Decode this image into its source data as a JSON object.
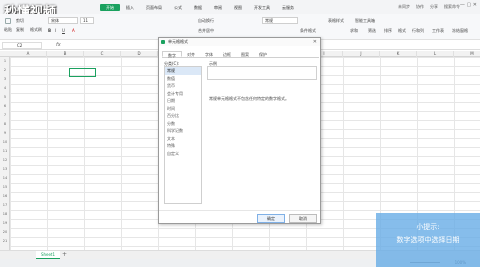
{
  "watermark": "秒懂视频",
  "menu": {
    "items": [
      "开始",
      "插入",
      "页面布局",
      "公式",
      "数据",
      "审阅",
      "视图",
      "开发工具",
      "云服务"
    ],
    "active_index": 0,
    "right_items": [
      "未同步",
      "协作",
      "分享",
      "搜索命令"
    ]
  },
  "ribbon": {
    "paste": "粘贴",
    "cut": "剪切",
    "copy": "复制",
    "format_painter": "格式刷",
    "font": "宋体",
    "size": "11",
    "wrap": "自动换行",
    "merge": "合并居中",
    "number_style": "常规",
    "cond_format": "条件格式",
    "table_style": "表格样式",
    "sum": "求和",
    "filter": "筛选",
    "sort": "排序",
    "format": "格式",
    "row_col": "行和列",
    "worksheet": "工作表",
    "freeze": "冻结窗格",
    "smart_toolbox": "智能工具箱"
  },
  "formula_bar": {
    "namebox": "C2",
    "fx": "fx"
  },
  "columns": [
    "A",
    "B",
    "C",
    "D",
    "E",
    "F",
    "G",
    "H",
    "I",
    "J",
    "K",
    "L",
    "M"
  ],
  "rows": [
    "1",
    "2",
    "3",
    "4",
    "5",
    "6",
    "7",
    "8",
    "9",
    "10",
    "11",
    "12",
    "13",
    "14",
    "15",
    "16",
    "17",
    "18",
    "19",
    "20",
    "21"
  ],
  "dialog": {
    "title": "单元格格式",
    "tabs": [
      "数字",
      "对齐",
      "字体",
      "边框",
      "图案",
      "保护"
    ],
    "active_tab": 0,
    "category_label": "分类(C):",
    "categories": [
      "常规",
      "数值",
      "货币",
      "会计专用",
      "日期",
      "时间",
      "百分比",
      "分数",
      "科学记数",
      "文本",
      "特殊",
      "自定义"
    ],
    "selected_category": 0,
    "sample_label": "示例",
    "description": "常规单元格格式不包含任何特定的数字格式。",
    "ok": "确定",
    "cancel": "取消"
  },
  "sheet": {
    "tab": "Sheet1",
    "add": "+"
  },
  "status": {
    "zoom": "100%"
  },
  "tip": {
    "title": "小提示:",
    "text": "数字选项中选择日期"
  }
}
